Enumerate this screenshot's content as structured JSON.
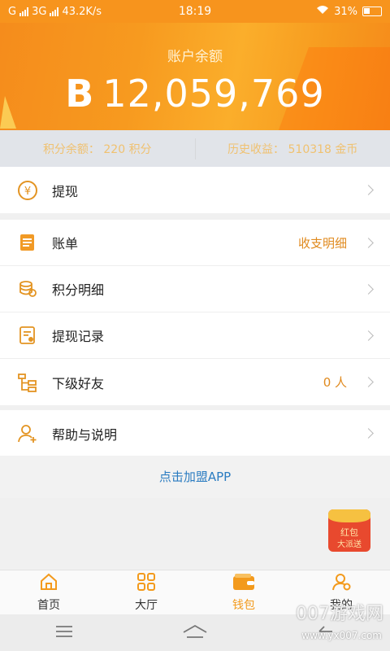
{
  "status_bar": {
    "carrier_left": "G",
    "carrier_right": "3G",
    "speed": "43.2K/s",
    "time": "18:19",
    "battery": "31%"
  },
  "header": {
    "title": "账户余额",
    "currency_symbol": "B",
    "balance": "12,059,769"
  },
  "summary": {
    "points_label": "积分余额：",
    "points_value": "220 积分",
    "history_label": "历史收益：",
    "history_value": "510318 金币"
  },
  "rows": {
    "withdraw": {
      "label": "提现"
    },
    "bill": {
      "label": "账单",
      "value": "收支明细"
    },
    "points_detail": {
      "label": "积分明细"
    },
    "withdraw_records": {
      "label": "提现记录"
    },
    "friends": {
      "label": "下级好友",
      "value": "0 人"
    },
    "help": {
      "label": "帮助与说明"
    }
  },
  "join_link": "点击加盟APP",
  "red_packet": {
    "line1": "红包",
    "line2": "大派送"
  },
  "tabs": [
    {
      "label": "首页",
      "icon": "home-icon"
    },
    {
      "label": "大厅",
      "icon": "grid-icon"
    },
    {
      "label": "钱包",
      "icon": "wallet-icon"
    },
    {
      "label": "我的",
      "icon": "user-icon"
    }
  ],
  "watermark": {
    "line1": "007游戏网",
    "line2": "www.yx007.com"
  },
  "colors": {
    "accent": "#f7941d",
    "link": "#2b7cc1",
    "value": "#e08a1e"
  }
}
